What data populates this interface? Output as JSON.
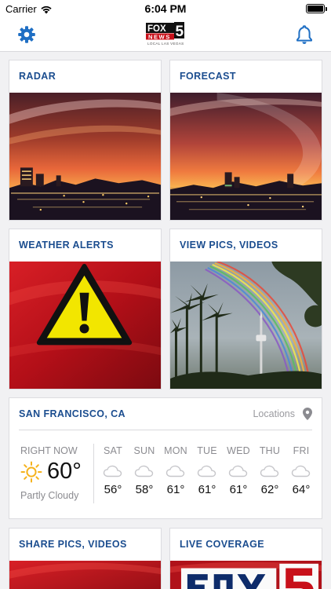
{
  "status_bar": {
    "carrier": "Carrier",
    "time": "6:04 PM"
  },
  "header": {
    "logo": {
      "brand": "FOX",
      "number": "5",
      "news": "NEWS",
      "tagline": "LOCAL LAS VEGAS"
    }
  },
  "tiles": [
    {
      "title": "RADAR"
    },
    {
      "title": "FORECAST"
    },
    {
      "title": "WEATHER ALERTS"
    },
    {
      "title": "VIEW PICS, VIDEOS"
    },
    {
      "title": "SHARE PICS, VIDEOS"
    },
    {
      "title": "LIVE COVERAGE"
    }
  ],
  "weather": {
    "location": "SAN FRANCISCO, CA",
    "locations_label": "Locations",
    "right_now_label": "RIGHT NOW",
    "current_temp": "60°",
    "current_condition": "Partly Cloudy",
    "current_icon": "sun-icon",
    "forecast": [
      {
        "day": "SAT",
        "temp": "56°",
        "icon": "cloud-icon"
      },
      {
        "day": "SUN",
        "temp": "58°",
        "icon": "cloud-icon"
      },
      {
        "day": "MON",
        "temp": "61°",
        "icon": "cloud-icon"
      },
      {
        "day": "TUE",
        "temp": "61°",
        "icon": "cloud-icon"
      },
      {
        "day": "WED",
        "temp": "61°",
        "icon": "cloud-icon"
      },
      {
        "day": "THU",
        "temp": "62°",
        "icon": "cloud-icon"
      },
      {
        "day": "FRI",
        "temp": "64°",
        "icon": "cloud-icon"
      }
    ]
  },
  "colors": {
    "title_blue": "#1b4d8f",
    "icon_blue": "#1f6fc4",
    "alert_red": "#c8101a",
    "alert_yellow": "#f2e600",
    "sun_yellow": "#f5b21c"
  }
}
